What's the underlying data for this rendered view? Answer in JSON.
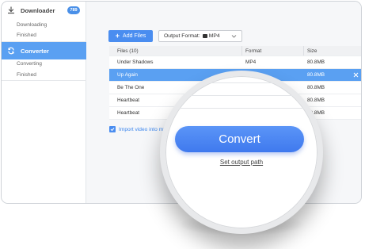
{
  "sidebar": {
    "downloader": {
      "label": "Downloader",
      "badge": "789",
      "icon": "download-icon"
    },
    "downloader_items": [
      "Downloading",
      "Finished"
    ],
    "converter": {
      "label": "Converter",
      "icon": "convert-icon"
    },
    "converter_items": [
      "Converting",
      "Finished"
    ]
  },
  "toolbar": {
    "add_files_label": "Add Files",
    "output_format_label": "Output Format:",
    "output_format_value": "MP4"
  },
  "table": {
    "headers": [
      "Files (10)",
      "Format",
      "Size"
    ],
    "rows": [
      {
        "name": "Under Shadows",
        "format": "MP4",
        "size": "80.8MB",
        "selected": false
      },
      {
        "name": "Up Again",
        "format": "",
        "size": "80.8MB",
        "selected": true
      },
      {
        "name": "Be The One",
        "format": "",
        "size": "80.8MB",
        "selected": false
      },
      {
        "name": "Heartbeat",
        "format": "",
        "size": "80.8MB",
        "selected": false
      },
      {
        "name": "Heartbeat",
        "format": "",
        "size": "80.8MB",
        "selected": false
      }
    ]
  },
  "import_label": "Import video into my d",
  "convert_label": "Convert",
  "output_path_label": "Set output path",
  "colors": {
    "accent": "#4a8df0",
    "selected_row": "#5aa0f2",
    "sidebar_active": "#5aa0f2"
  }
}
